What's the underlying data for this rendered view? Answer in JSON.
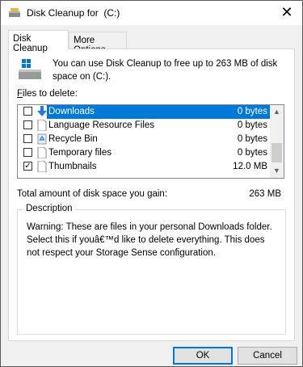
{
  "window": {
    "title": "Disk Cleanup for  (C:)",
    "close_glyph": "✕"
  },
  "tabs": [
    {
      "label": "Disk Cleanup",
      "active": true
    },
    {
      "label": "More Options",
      "active": false
    }
  ],
  "intro": {
    "text": "You can use Disk Cleanup to free up to 263 MB of disk space on  (C:)."
  },
  "files": {
    "label_prefix": "F",
    "label_rest": "iles to delete:",
    "items": [
      {
        "name": "Downloads",
        "size": "0 bytes",
        "checked": false,
        "selected": true,
        "icon": "download-arrow-icon"
      },
      {
        "name": "Language Resource Files",
        "size": "0 bytes",
        "checked": false,
        "selected": false,
        "icon": "document-icon"
      },
      {
        "name": "Recycle Bin",
        "size": "0 bytes",
        "checked": false,
        "selected": false,
        "icon": "recycle-bin-icon"
      },
      {
        "name": "Temporary files",
        "size": "0 bytes",
        "checked": false,
        "selected": false,
        "icon": "document-icon"
      },
      {
        "name": "Thumbnails",
        "size": "12.0 MB",
        "checked": true,
        "selected": false,
        "icon": "document-icon"
      }
    ]
  },
  "total": {
    "label": "Total amount of disk space you gain:",
    "value": "263 MB"
  },
  "description": {
    "title": "Description",
    "text": "Warning: These are files in your personal Downloads folder. Select this if youâ€™d like to delete everything. This does not respect your Storage Sense configuration."
  },
  "buttons": {
    "ok": "OK",
    "cancel": "Cancel"
  },
  "colors": {
    "selection": "#0078d7",
    "dialog_bg": "#f0f0f0"
  }
}
